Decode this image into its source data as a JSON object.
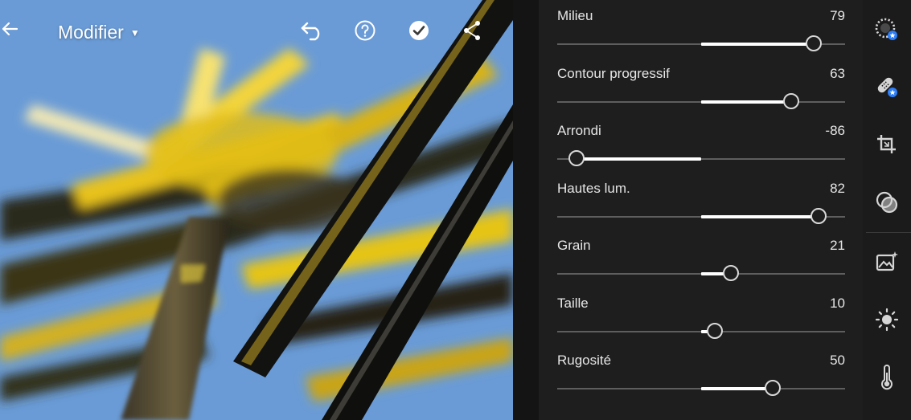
{
  "header": {
    "title": "Modifier",
    "icons": [
      "back-arrow-icon",
      "caret-down-icon",
      "undo-icon",
      "help-icon",
      "check-icon",
      "share-icon",
      "more-vertical-icon"
    ]
  },
  "sliders": [
    {
      "label": "Milieu",
      "value": "79",
      "level": 79
    },
    {
      "label": "Contour progressif",
      "value": "63",
      "level": 63
    },
    {
      "label": "Arrondi",
      "value": "-86",
      "level": -86
    },
    {
      "label": "Hautes lum.",
      "value": "82",
      "level": 82
    },
    {
      "label": "Grain",
      "value": "21",
      "level": 21
    },
    {
      "label": "Taille",
      "value": "10",
      "level": 10
    },
    {
      "label": "Rugosité",
      "value": "50",
      "level": 50
    }
  ],
  "rail": {
    "icons": [
      "auto-presets-icon",
      "healing-bandage-icon",
      "crop-icon",
      "selective-masks-icon",
      "effects-image-icon",
      "light-sun-icon",
      "color-temperature-icon"
    ],
    "accent": "#2d7ff9"
  },
  "colors": {
    "panel_bg": "#1e1e1e",
    "track": "#5e5e5e",
    "fill": "#ffffff"
  }
}
